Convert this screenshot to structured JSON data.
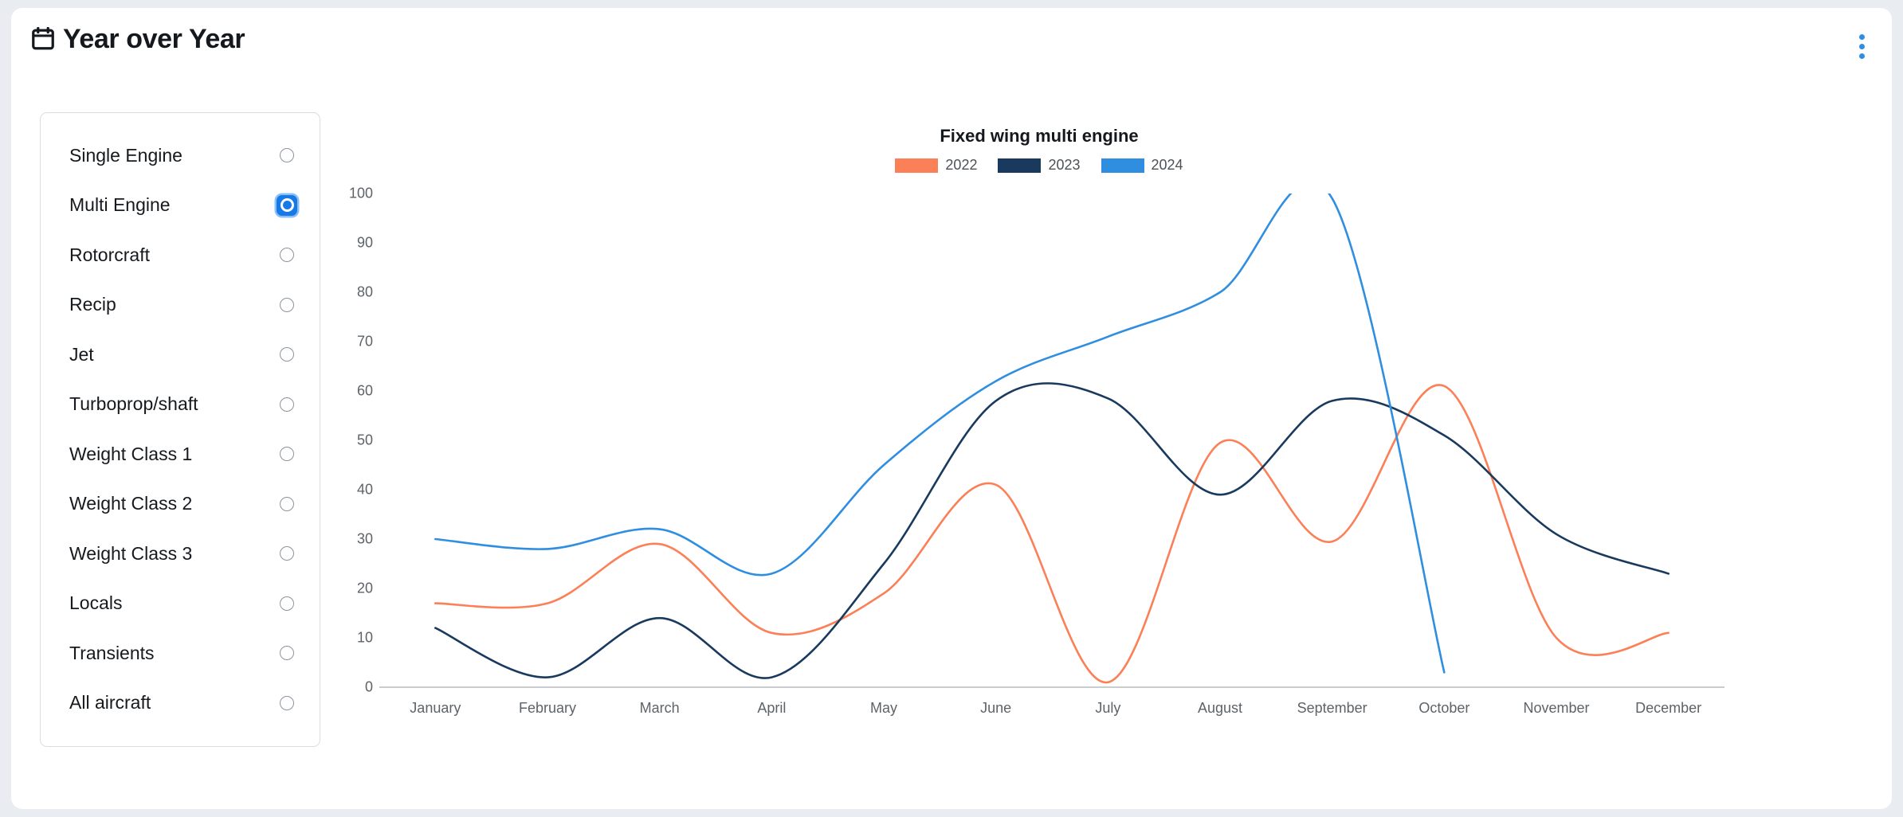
{
  "header": {
    "title": "Year over Year",
    "calendar_icon": "calendar-icon",
    "menu_icon": "kebab-menu-icon"
  },
  "sidebar": {
    "items": [
      {
        "label": "Single Engine",
        "selected": false
      },
      {
        "label": "Multi Engine",
        "selected": true
      },
      {
        "label": "Rotorcraft",
        "selected": false
      },
      {
        "label": "Recip",
        "selected": false
      },
      {
        "label": "Jet",
        "selected": false
      },
      {
        "label": "Turboprop/shaft",
        "selected": false
      },
      {
        "label": "Weight Class 1",
        "selected": false
      },
      {
        "label": "Weight Class 2",
        "selected": false
      },
      {
        "label": "Weight Class 3",
        "selected": false
      },
      {
        "label": "Locals",
        "selected": false
      },
      {
        "label": "Transients",
        "selected": false
      },
      {
        "label": "All aircraft",
        "selected": false
      }
    ]
  },
  "colors": {
    "series_2022": "#fb7f57",
    "series_2023": "#193a5e",
    "series_2024": "#2f8ee0",
    "grid": "#e6e6e6",
    "axis_text": "#5d6368",
    "page_bg": "#e9edf1",
    "card_bg": "#ffffff",
    "accent": "#1579e8"
  },
  "chart_data": {
    "type": "line",
    "title": "Fixed wing multi engine",
    "xlabel": "",
    "ylabel": "",
    "ylim": [
      0,
      100
    ],
    "yticks": [
      0,
      10,
      20,
      30,
      40,
      50,
      60,
      70,
      80,
      90,
      100
    ],
    "grid": true,
    "legend_position": "top-center",
    "smoothing": "spline",
    "categories": [
      "January",
      "February",
      "March",
      "April",
      "May",
      "June",
      "July",
      "August",
      "September",
      "October",
      "November",
      "December"
    ],
    "series": [
      {
        "name": "2022",
        "color": "#fb7f57",
        "values": [
          17,
          17,
          29,
          11,
          19,
          41,
          1,
          49.5,
          29.5,
          61,
          10,
          11
        ]
      },
      {
        "name": "2023",
        "color": "#193a5e",
        "values": [
          12,
          2,
          14,
          2,
          25,
          58,
          58.5,
          39,
          58,
          51,
          31,
          23
        ]
      },
      {
        "name": "2024",
        "color": "#2f8ee0",
        "values": [
          30,
          28,
          32,
          23,
          45,
          62,
          71,
          80,
          99,
          3,
          null,
          null
        ]
      }
    ]
  }
}
